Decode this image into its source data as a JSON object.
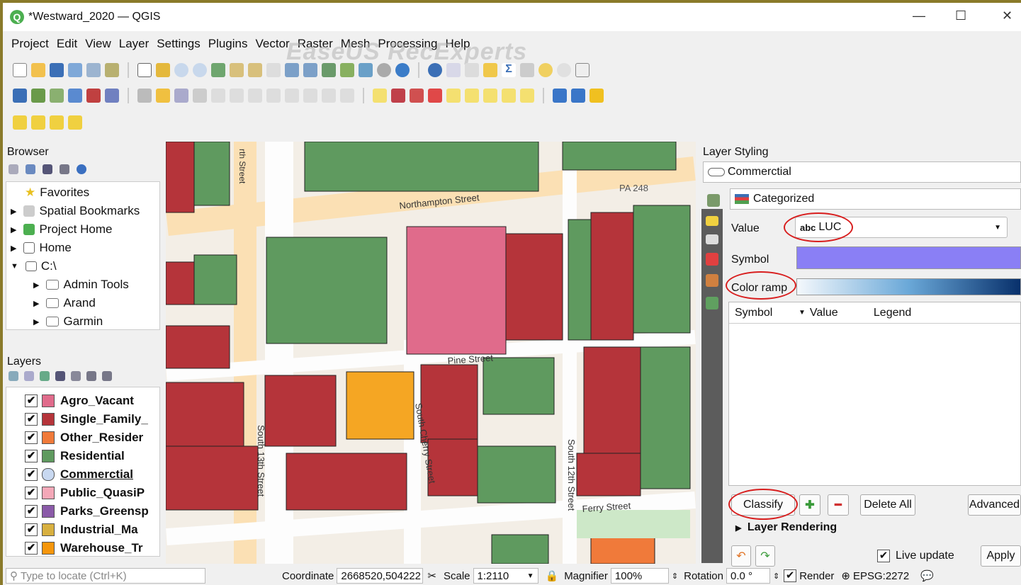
{
  "window": {
    "title": "*Westward_2020 — QGIS",
    "min": "—",
    "max": "☐",
    "close": "✕"
  },
  "menu": [
    "Project",
    "Edit",
    "View",
    "Layer",
    "Settings",
    "Plugins",
    "Vector",
    "Raster",
    "Mesh",
    "Processing",
    "Help"
  ],
  "watermark": "EaseUS RecExperts",
  "browser": {
    "title": "Browser",
    "items": [
      {
        "label": "Favorites",
        "icon": "star-icon",
        "indent": 0
      },
      {
        "label": "Spatial Bookmarks",
        "icon": "bookmark-icon",
        "indent": 0
      },
      {
        "label": "Project Home",
        "icon": "project-home-icon",
        "indent": 0
      },
      {
        "label": "Home",
        "icon": "home-icon",
        "indent": 0
      },
      {
        "label": "C:\\",
        "icon": "drive-icon",
        "indent": 0
      },
      {
        "label": "Admin Tools",
        "icon": "folder-icon",
        "indent": 1
      },
      {
        "label": "Arand",
        "icon": "folder-icon",
        "indent": 1
      },
      {
        "label": "Garmin",
        "icon": "folder-icon",
        "indent": 1
      }
    ]
  },
  "layers": {
    "title": "Layers",
    "items": [
      {
        "label": "Agro_Vacant",
        "color": "#e06b8b"
      },
      {
        "label": "Single_Family_",
        "color": "#b5343a"
      },
      {
        "label": "Other_Resider",
        "color": "#f07a3a"
      },
      {
        "label": "Residential",
        "color": "#5f9a5f"
      },
      {
        "label": "Commerctial",
        "color": "#c8d8f0"
      },
      {
        "label": "Public_QuasiP",
        "color": "#f4a8b8"
      },
      {
        "label": "Parks_Greensp",
        "color": "#8a5aa8"
      },
      {
        "label": "Industrial_Ma",
        "color": "#d8b040"
      },
      {
        "label": "Warehouse_Tr",
        "color": "#f5960c"
      }
    ]
  },
  "map_labels": {
    "street_northampton": "Northampton Street",
    "street_pine": "Pine Street",
    "street_pa248": "PA 248",
    "street_south13": "South 13th Street",
    "street_cherry": "South Cherry Street",
    "street_south12": "South 12th Street",
    "street_ferry": "Ferry Street",
    "street_north": "rth Street"
  },
  "styling": {
    "title": "Layer Styling",
    "layer": "Commerctial",
    "renderer": "Categorized",
    "value_label": "Value",
    "value_field": "LUC",
    "value_prefix": "abc",
    "symbol_label": "Symbol",
    "color_ramp_label": "Color ramp",
    "columns": [
      "Symbol",
      "Value",
      "Legend"
    ],
    "classify": "Classify",
    "delete_all": "Delete All",
    "advanced": "Advanced",
    "layer_rendering": "Layer Rendering",
    "live_update": "Live update",
    "apply": "Apply",
    "symbol_color": "#8a7ff5"
  },
  "status": {
    "locate_placeholder": "Type to locate (Ctrl+K)",
    "coordinate_label": "Coordinate",
    "coordinate": "2668520,504222",
    "scale_label": "Scale",
    "scale": "1:2110",
    "magnifier_label": "Magnifier",
    "magnifier": "100%",
    "rotation_label": "Rotation",
    "rotation": "0.0 °",
    "render_label": "Render",
    "crs": "EPSG:2272"
  }
}
